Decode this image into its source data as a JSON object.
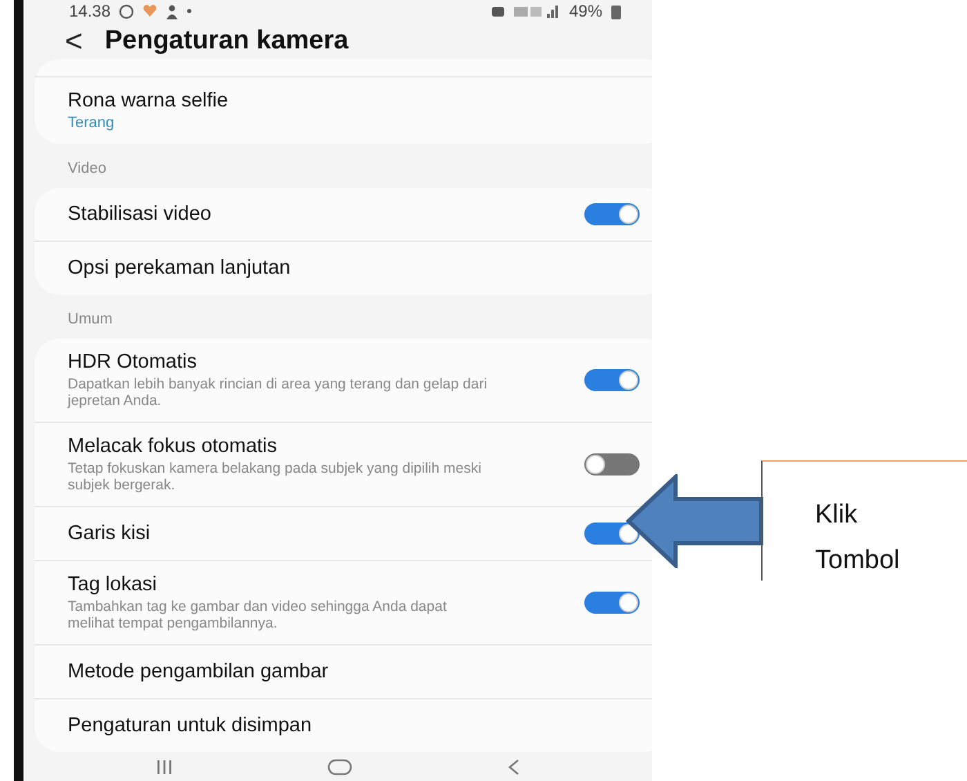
{
  "status_bar": {
    "time": "14.38",
    "battery": "49%"
  },
  "header": {
    "back": "<",
    "title": "Pengaturan kamera"
  },
  "groups": [
    {
      "items": [
        {
          "kind": "value",
          "title": "Rona warna selfie",
          "value": "Terang"
        }
      ]
    },
    {
      "header": "Video",
      "items": [
        {
          "kind": "toggle",
          "title": "Stabilisasi video",
          "on": true
        },
        {
          "kind": "link",
          "title": "Opsi perekaman lanjutan"
        }
      ]
    },
    {
      "header": "Umum",
      "items": [
        {
          "kind": "toggle",
          "title": "HDR Otomatis",
          "description": "Dapatkan lebih banyak rincian di area yang terang dan gelap dari jepretan Anda.",
          "on": true
        },
        {
          "kind": "toggle",
          "title": "Melacak fokus otomatis",
          "description": "Tetap fokuskan kamera belakang pada subjek yang dipilih meski subjek bergerak.",
          "on": false
        },
        {
          "kind": "toggle",
          "title": "Garis kisi",
          "on": true
        },
        {
          "kind": "toggle",
          "title": "Tag lokasi",
          "description": "Tambahkan tag ke gambar dan video sehingga Anda dapat melihat tempat pengambilannya.",
          "on": true
        },
        {
          "kind": "link",
          "title": "Metode pengambilan gambar"
        },
        {
          "kind": "link",
          "title": "Pengaturan untuk disimpan"
        }
      ]
    }
  ],
  "callout": {
    "lines": [
      "Klik",
      "Tombol"
    ]
  }
}
